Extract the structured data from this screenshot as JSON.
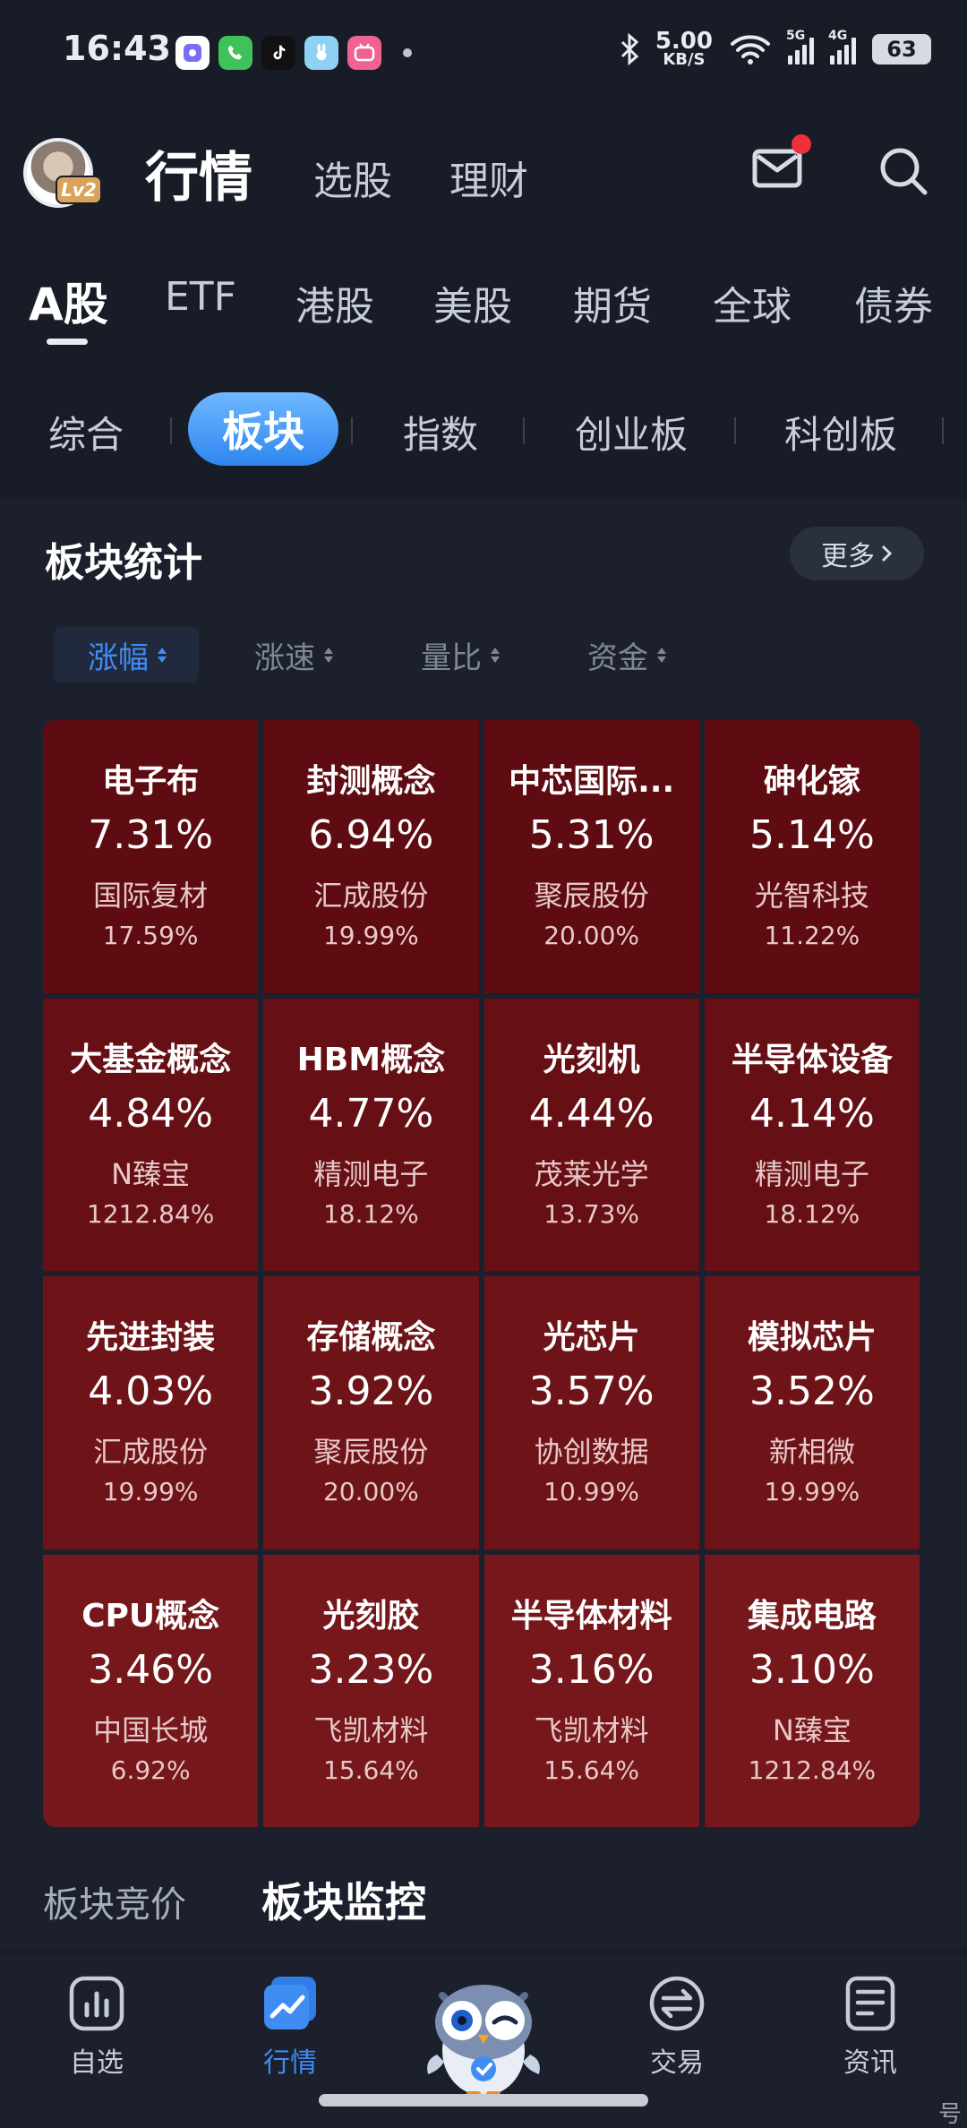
{
  "status_bar": {
    "time": "16:43",
    "speed_value": "5.00",
    "speed_unit": "KB/S",
    "net1": "5G",
    "net2": "4G",
    "battery": "63"
  },
  "top_nav": {
    "avatar_badge": "Lv2",
    "title": "行情",
    "items": [
      "选股",
      "理财"
    ]
  },
  "market_tabs": [
    "A股",
    "ETF",
    "港股",
    "美股",
    "期货",
    "全球",
    "债券"
  ],
  "sub_tabs": [
    "综合",
    "板块",
    "指数",
    "创业板",
    "科创板"
  ],
  "section": {
    "title": "板块统计",
    "more_label": "更多"
  },
  "sort_options": [
    "涨幅",
    "涨速",
    "量比",
    "资金"
  ],
  "sectors": [
    {
      "name": "电子布",
      "pct": "7.31%",
      "stock": "国际复材",
      "stock_pct": "17.59%"
    },
    {
      "name": "封测概念",
      "pct": "6.94%",
      "stock": "汇成股份",
      "stock_pct": "19.99%"
    },
    {
      "name": "中芯国际...",
      "pct": "5.31%",
      "stock": "聚辰股份",
      "stock_pct": "20.00%"
    },
    {
      "name": "砷化镓",
      "pct": "5.14%",
      "stock": "光智科技",
      "stock_pct": "11.22%"
    },
    {
      "name": "大基金概念",
      "pct": "4.84%",
      "stock": "N臻宝",
      "stock_pct": "1212.84%"
    },
    {
      "name": "HBM概念",
      "pct": "4.77%",
      "stock": "精测电子",
      "stock_pct": "18.12%"
    },
    {
      "name": "光刻机",
      "pct": "4.44%",
      "stock": "茂莱光学",
      "stock_pct": "13.73%"
    },
    {
      "name": "半导体设备",
      "pct": "4.14%",
      "stock": "精测电子",
      "stock_pct": "18.12%"
    },
    {
      "name": "先进封装",
      "pct": "4.03%",
      "stock": "汇成股份",
      "stock_pct": "19.99%"
    },
    {
      "name": "存储概念",
      "pct": "3.92%",
      "stock": "聚辰股份",
      "stock_pct": "20.00%"
    },
    {
      "name": "光芯片",
      "pct": "3.57%",
      "stock": "协创数据",
      "stock_pct": "10.99%"
    },
    {
      "name": "模拟芯片",
      "pct": "3.52%",
      "stock": "新相微",
      "stock_pct": "19.99%"
    },
    {
      "name": "CPU概念",
      "pct": "3.46%",
      "stock": "中国长城",
      "stock_pct": "6.92%"
    },
    {
      "name": "光刻胶",
      "pct": "3.23%",
      "stock": "飞凯材料",
      "stock_pct": "15.64%"
    },
    {
      "name": "半导体材料",
      "pct": "3.16%",
      "stock": "飞凯材料",
      "stock_pct": "15.64%"
    },
    {
      "name": "集成电路",
      "pct": "3.10%",
      "stock": "N臻宝",
      "stock_pct": "1212.84%"
    }
  ],
  "cell_colors": [
    "#5e0c12",
    "#660f15",
    "#6e1318",
    "#76171b"
  ],
  "lower_tabs": [
    "板块竞价",
    "板块监控"
  ],
  "bottom_nav": [
    "自选",
    "行情",
    "交易",
    "资讯"
  ],
  "edge_char": "号",
  "colors": {
    "background": "#171c27",
    "accent_blue": "#3f8cf3",
    "notification": "#f0303a"
  }
}
